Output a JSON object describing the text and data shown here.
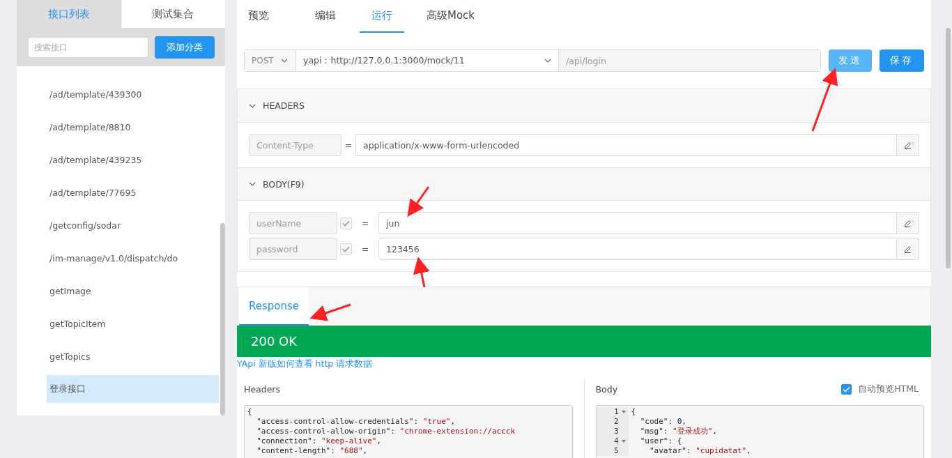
{
  "sidebar": {
    "tabs": [
      {
        "label": "接口列表",
        "selected": true
      },
      {
        "label": "测试集合",
        "selected": false
      }
    ],
    "search": {
      "placeholder": "搜索接口"
    },
    "add_button": "添加分类",
    "items": [
      {
        "label": "/ad/template/439300",
        "selected": false
      },
      {
        "label": "/ad/template/8810",
        "selected": false
      },
      {
        "label": "/ad/template/439235",
        "selected": false
      },
      {
        "label": "/ad/template/77695",
        "selected": false
      },
      {
        "label": "/getconfig/sodar",
        "selected": false
      },
      {
        "label": "/im-manage/v1.0/dispatch/do",
        "selected": false
      },
      {
        "label": "getImage",
        "selected": false
      },
      {
        "label": "getTopicItem",
        "selected": false
      },
      {
        "label": "getTopics",
        "selected": false
      },
      {
        "label": "登录接口",
        "selected": true
      }
    ]
  },
  "tabs": [
    {
      "label": "预览",
      "selected": false
    },
    {
      "label": "编辑",
      "selected": false
    },
    {
      "label": "运行",
      "selected": true
    },
    {
      "label": "高级Mock",
      "selected": false
    }
  ],
  "request": {
    "method": "POST",
    "host": "yapi：http://127.0.0.1:3000/mock/11",
    "path": "/api/login",
    "send_button": "发送",
    "save_button": "保存"
  },
  "headers_section": {
    "title": "HEADERS",
    "separator": "=",
    "expanded": true,
    "rows": [
      {
        "name": "Content-Type",
        "value": "application/x-www-form-urlencoded"
      }
    ]
  },
  "body_section": {
    "title": "BODY(F9)",
    "separator": "=",
    "expanded": true,
    "rows": [
      {
        "name": "userName",
        "enabled": true,
        "value": "jun"
      },
      {
        "name": "password",
        "enabled": true,
        "value": "123456"
      }
    ]
  },
  "response": {
    "tab": "Response",
    "status": "200 OK",
    "help_link": "YApi 新版如何查看 http 请求数据",
    "headers_label": "Headers",
    "body_label": "Body",
    "auto_preview": {
      "label": "自动预览HTML",
      "checked": true
    },
    "headers_lines": [
      [
        {
          "text": "{",
          "kind": "punct"
        }
      ],
      [
        {
          "text": "  \"access-control-allow-credentials\": ",
          "kind": "key"
        },
        {
          "text": "\"true\"",
          "kind": "string"
        },
        {
          "text": ",",
          "kind": "punct"
        }
      ],
      [
        {
          "text": "  \"access-control-allow-origin\": ",
          "kind": "key"
        },
        {
          "text": "\"chrome-extension://accck",
          "kind": "string"
        }
      ],
      [
        {
          "text": "  \"connection\": ",
          "kind": "key"
        },
        {
          "text": "\"keep-alive\"",
          "kind": "string"
        },
        {
          "text": ",",
          "kind": "punct"
        }
      ],
      [
        {
          "text": "  \"content-length\": ",
          "kind": "key"
        },
        {
          "text": "\"688\"",
          "kind": "string"
        },
        {
          "text": ",",
          "kind": "punct"
        }
      ]
    ],
    "body_lines": [
      {
        "number": "1",
        "foldable": true,
        "tokens": [
          {
            "text": "{",
            "kind": "punct"
          }
        ]
      },
      {
        "number": "2",
        "foldable": false,
        "tokens": [
          {
            "text": "  \"code\": ",
            "kind": "key"
          },
          {
            "text": "0",
            "kind": "number"
          },
          {
            "text": ",",
            "kind": "punct"
          }
        ]
      },
      {
        "number": "3",
        "foldable": false,
        "tokens": [
          {
            "text": "  \"msg\": ",
            "kind": "key"
          },
          {
            "text": "\"登录成功\"",
            "kind": "string"
          },
          {
            "text": ",",
            "kind": "punct"
          }
        ]
      },
      {
        "number": "4",
        "foldable": true,
        "tokens": [
          {
            "text": "  \"user\": {",
            "kind": "key"
          }
        ]
      },
      {
        "number": "5",
        "foldable": false,
        "tokens": [
          {
            "text": "    \"avatar\": ",
            "kind": "key"
          },
          {
            "text": "\"cupidatat\"",
            "kind": "string"
          },
          {
            "text": ",",
            "kind": "punct"
          }
        ]
      }
    ]
  }
}
